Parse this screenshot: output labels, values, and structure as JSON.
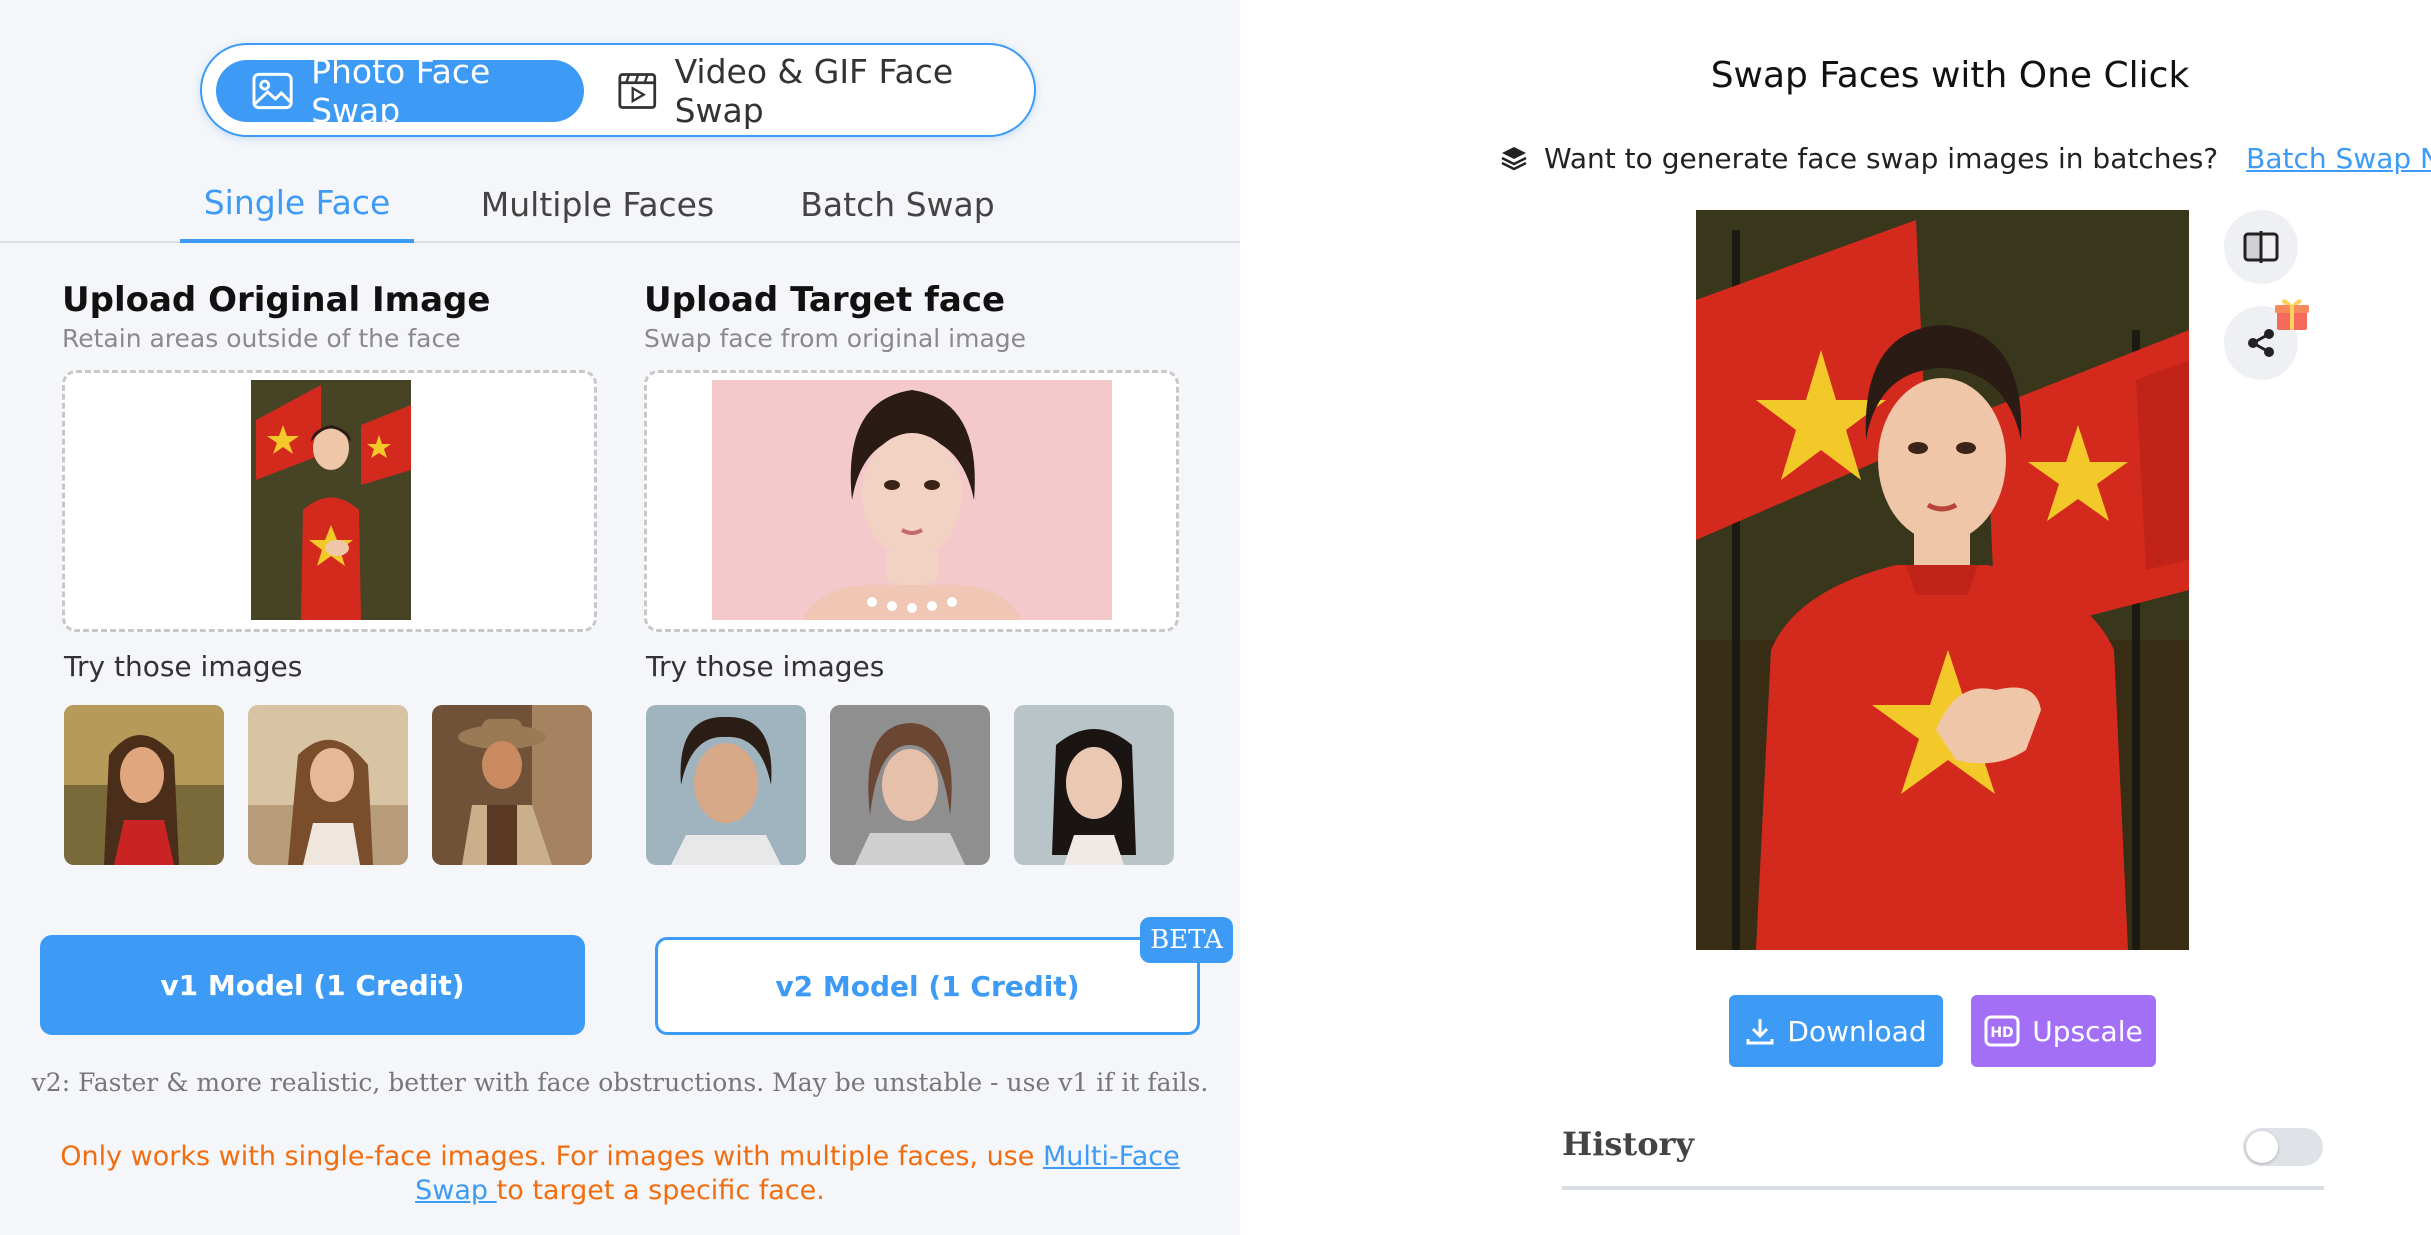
{
  "mode_toggle": {
    "photo_label": "Photo Face Swap",
    "video_label": "Video & GIF Face Swap"
  },
  "tabs": [
    {
      "label": "Single Face",
      "active": true
    },
    {
      "label": "Multiple Faces",
      "active": false
    },
    {
      "label": "Batch Swap",
      "active": false
    }
  ],
  "original": {
    "title": "Upload Original Image",
    "subtitle": "Retain areas outside of the face",
    "try_label": "Try those images"
  },
  "target": {
    "title": "Upload Target face",
    "subtitle": "Swap face from original image",
    "try_label": "Try those images"
  },
  "models": {
    "v1_label": "v1 Model (1 Credit)",
    "v2_label": "v2 Model (1 Credit)",
    "beta_badge": "BETA"
  },
  "note": "v2: Faster & more realistic, better with face obstructions. May be unstable - use v1 if it fails.",
  "warning": {
    "prefix": "Only works with single-face images. For images with multiple faces, use ",
    "link": "Multi-Face Swap ",
    "suffix": "to target a specific face."
  },
  "result_panel": {
    "title": "Swap Faces with One Click",
    "batch_prompt": "Want to generate face swap images in batches?",
    "batch_link": "Batch Swap Now",
    "download_label": "Download",
    "upscale_label": "Upscale",
    "upscale_badge": "HD",
    "history_title": "History",
    "history_enabled": false
  },
  "colors": {
    "accent": "#3d9bf5",
    "upscale": "#a36ff7",
    "warning": "#f26d0f",
    "flag_red": "#d42a1e",
    "flag_star": "#f3c92a"
  },
  "icons": [
    "image-icon",
    "video-icon",
    "layers-icon",
    "compare-icon",
    "share-icon",
    "gift-icon",
    "download-icon",
    "hd-icon"
  ]
}
